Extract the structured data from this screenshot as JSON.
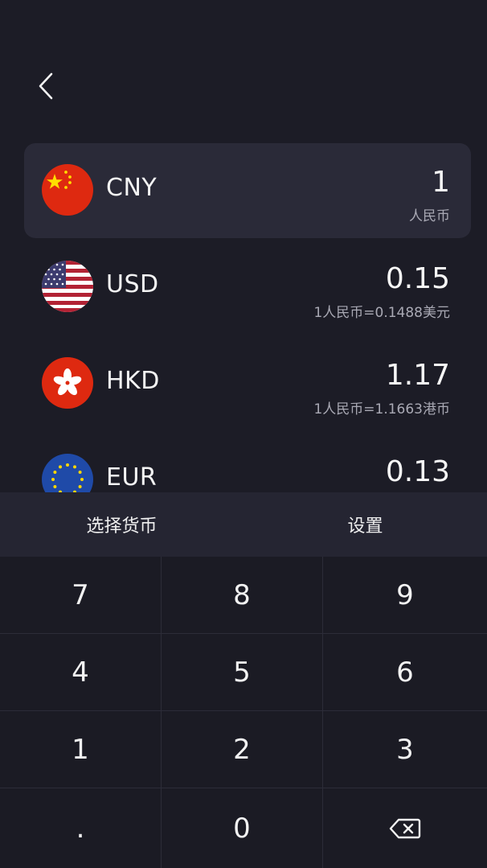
{
  "header": {
    "back_icon": "chevron-left-icon"
  },
  "currencies": [
    {
      "code": "CNY",
      "amount": "1",
      "rate_text": "人民币",
      "flag": "china-flag-icon"
    },
    {
      "code": "USD",
      "amount": "0.15",
      "rate_text": "1人民币=0.1488美元",
      "flag": "usa-flag-icon"
    },
    {
      "code": "HKD",
      "amount": "1.17",
      "rate_text": "1人民币=1.1663港币",
      "flag": "hong-kong-flag-icon"
    },
    {
      "code": "EUR",
      "amount": "0.13",
      "rate_text": "",
      "flag": "eu-flag-icon"
    }
  ],
  "bottom_bar": {
    "select_label": "选择货币",
    "settings_label": "设置"
  },
  "keypad": {
    "keys": [
      "7",
      "8",
      "9",
      "4",
      "5",
      "6",
      "1",
      "2",
      "3",
      ".",
      "0"
    ],
    "backspace_icon": "backspace-icon"
  },
  "colors": {
    "background": "#1c1c26",
    "active_row": "#2a2a38",
    "bar": "#252532"
  }
}
